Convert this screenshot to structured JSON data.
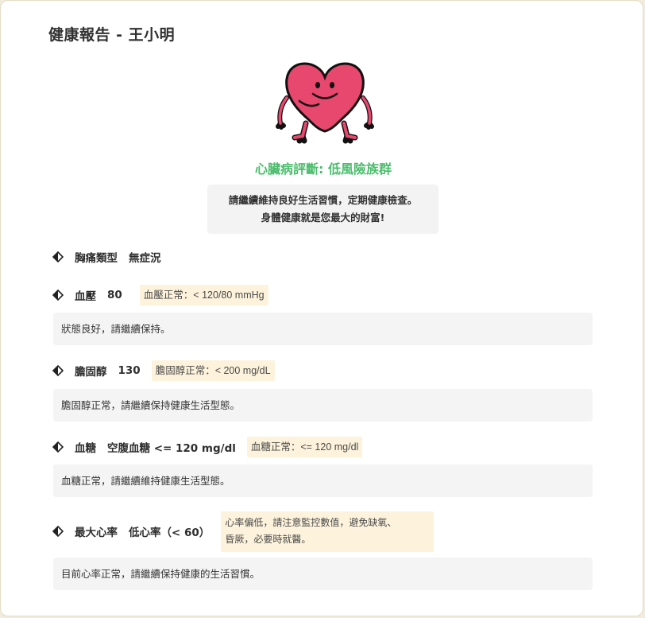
{
  "report": {
    "title": "健康報告 - 王小明"
  },
  "mascot": {
    "icon": "heart-mascot-icon",
    "color": "#e8476e"
  },
  "diagnosis": {
    "text": "心臟病評斷: 低風險族群",
    "color": "#4bbd6d"
  },
  "advice": {
    "line1": "請繼續維持良好生活習慣，定期健康檢查。",
    "line2": "身體健康就是您最大的財富!"
  },
  "items": {
    "chest_pain": {
      "name": "胸痛類型",
      "value": "無症況"
    },
    "blood_pressure": {
      "name": "血壓",
      "value": "80",
      "tag": "血壓正常：< 120/80 mmHg",
      "note": "狀態良好，請繼續保持。"
    },
    "cholesterol": {
      "name": "膽固醇",
      "value": "130",
      "tag": "膽固醇正常：< 200 mg/dL",
      "note": "膽固醇正常，請繼續保持健康生活型態。"
    },
    "blood_sugar": {
      "name": "血糖",
      "value": "空腹血糖 <= 120 mg/dl",
      "tag": "血糖正常：<= 120 mg/dl",
      "note": "血糖正常，請繼續維持健康生活型態。"
    },
    "max_heart_rate": {
      "name": "最大心率",
      "value": "低心率（< 60）",
      "tag_line1": "心率偏低，請注意監控數值，避免缺氧、",
      "tag_line2": "昏厥，必要時就醫。",
      "note": "目前心率正常，請繼續保持健康的生活習慣。"
    }
  },
  "colors": {
    "tag_background": "#fdf3dc",
    "note_background": "#f4f4f4"
  }
}
